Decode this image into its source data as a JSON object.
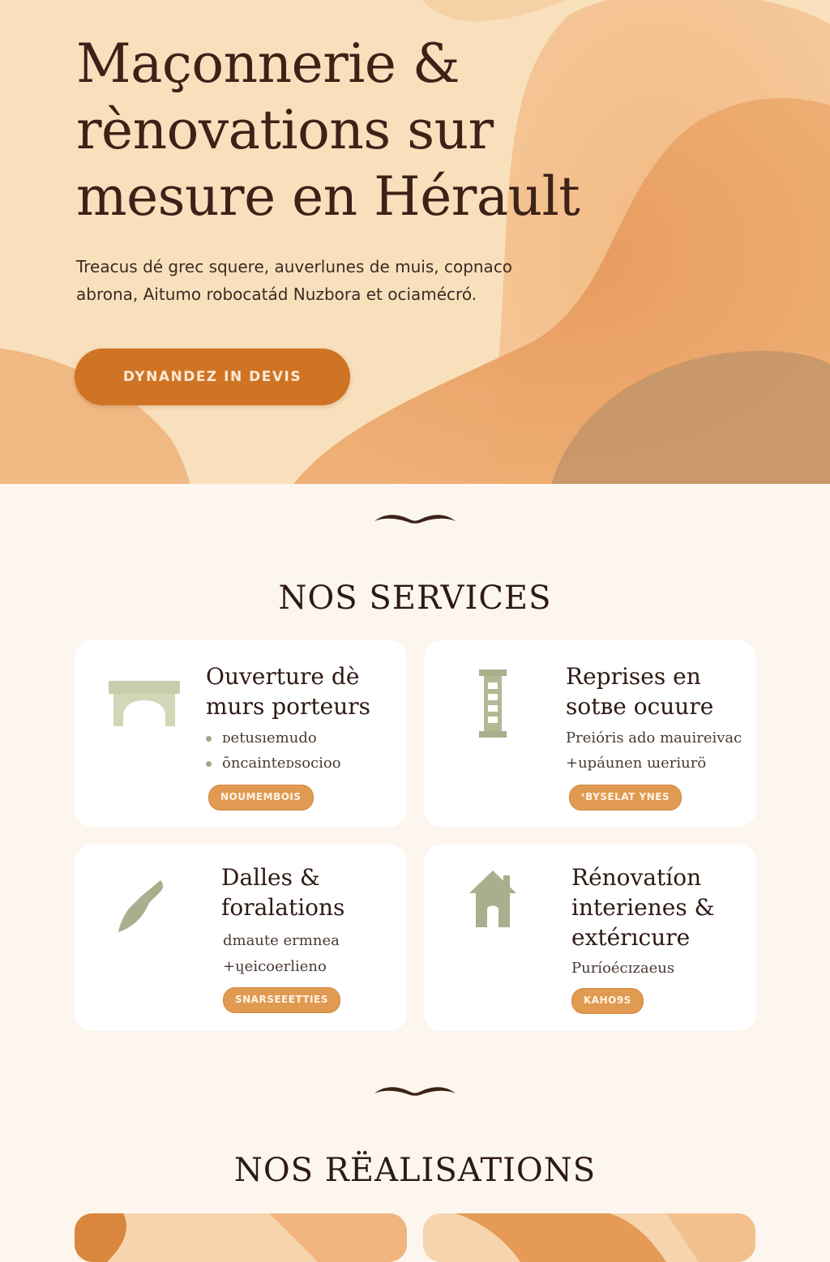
{
  "hero": {
    "title": "Maçonnerie & rènovations sur mesure en Hérault",
    "text": "Treacus dé grec squere, auverlunes de muis, copnaco abrona, Аitumo robocatád Nuzbora et ociamécró.",
    "cta_label": "DYNANDEZ IN DEVIS"
  },
  "services": {
    "title": "NOS SERVICES",
    "cards": [
      {
        "icon": "arch-icon",
        "title": "Ouverture dè murs porteurs",
        "lines": [
          "ᴅetusıemudo",
          "ōncainteᴅsocioo"
        ],
        "tag": "NOUMEMBOIS"
      },
      {
        "icon": "pillar-icon",
        "title": "Reprises en sotʙe ocuure",
        "lines": [
          "Preióris ado mauireivac",
          "+upáunen ɯeriurö"
        ],
        "tag": "ᵗBYSELAT YNES"
      },
      {
        "icon": "trowel-icon",
        "title": "Dalles & foralations",
        "lines": [
          "dmaute ermnea",
          "+ɥeicoerlieno"
        ],
        "tag": "SNARSEEETTIES"
      },
      {
        "icon": "house-icon",
        "title": "Rénovatíon interienes & extérıcure",
        "lines": [
          "Puríoécɪzaeus"
        ],
        "tag": "KAHO9S"
      }
    ]
  },
  "realisations": {
    "title": "NOS RËALISATIONS"
  },
  "colors": {
    "accent": "#cf7424",
    "text_dark": "#3d2218",
    "icon_green": "#a9a48a",
    "tag_orange": "#e09a52"
  }
}
